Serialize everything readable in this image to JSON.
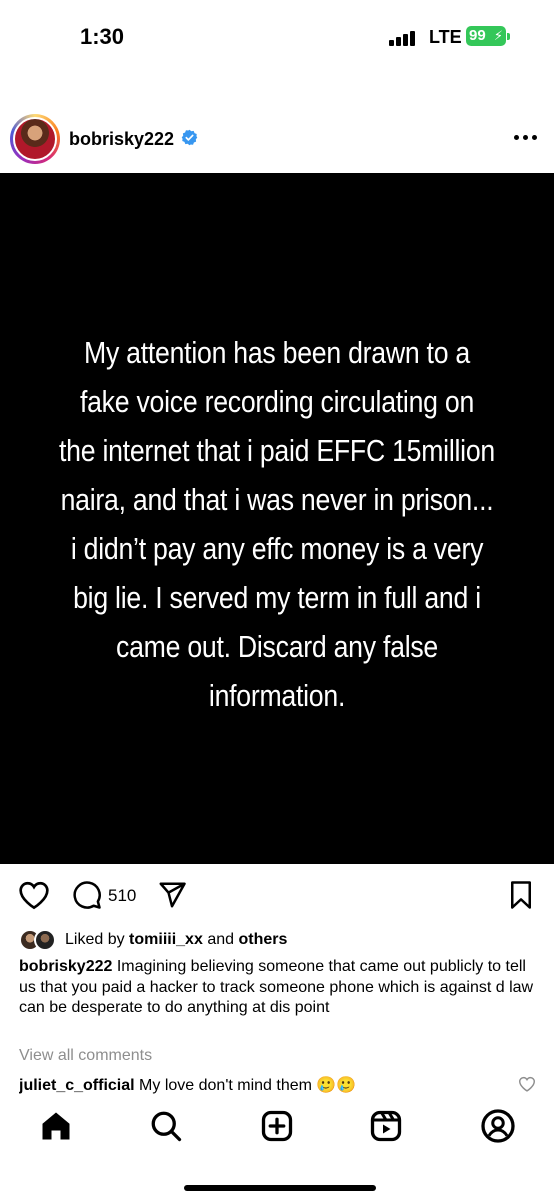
{
  "status_bar": {
    "time": "1:30",
    "network": "LTE",
    "battery": "99"
  },
  "post": {
    "username": "bobrisky222",
    "verified_icon": "verified-badge-icon",
    "menu_icon": "more-options-icon",
    "image_text": "My attention has been drawn to a fake voice recording circulating on the internet that i paid EFFC 15million naira, and that i was never in prison... i didn't pay any effc money  is a very big lie. I served my term in full and i came out. Discard any false information.",
    "image_lines": [
      "My attention has been drawn to a",
      "fake voice recording circulating on",
      "the internet that i paid EFFC 15million",
      "naira, and that i was never in prison...",
      "i didn’t pay any effc money  is a very",
      "big lie. I served my term in full and i",
      "came out. Discard any false",
      "information."
    ],
    "comment_count": "510",
    "liked_prefix": "Liked by",
    "liked_user": "tomiiii_xx",
    "liked_and": "and",
    "liked_others": "others",
    "caption_user": "bobrisky222",
    "caption_text": "Imagining believing someone that came out publicly to tell us that you paid a hacker to track someone phone which is against d law can be desperate to do anything at dis point",
    "view_comments": "View all comments",
    "comment_user": "juliet_c_official",
    "comment_text": "My love don't mind them 🥲🥲"
  },
  "actions": {
    "like_icon": "heart-icon",
    "comment_icon": "comment-icon",
    "share_icon": "send-icon",
    "save_icon": "bookmark-icon"
  },
  "tabs": [
    "home-icon",
    "search-icon",
    "create-icon",
    "reels-icon",
    "profile-icon"
  ],
  "colors": {
    "verified": "#3897f0",
    "battery": "#34c759",
    "muted": "#8e8e8e"
  }
}
